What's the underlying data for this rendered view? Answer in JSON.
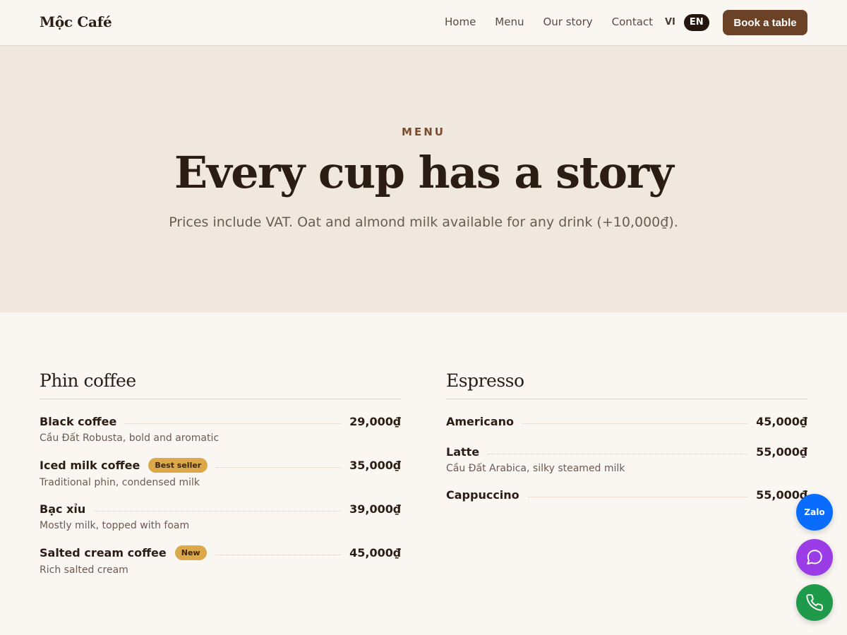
{
  "header": {
    "brand": "Mộc Café",
    "nav": [
      "Home",
      "Menu",
      "Our story",
      "Contact"
    ],
    "lang": [
      "VI",
      "EN"
    ],
    "active_lang": "EN",
    "book_label": "Book a table"
  },
  "hero": {
    "eyebrow": "MENU",
    "title": "Every cup has a story",
    "subtitle": "Prices include VAT. Oat and almond milk available for any drink (+10,000₫)."
  },
  "sections": [
    {
      "title": "Phin coffee",
      "items": [
        {
          "name": "Black coffee",
          "price": "29,000₫",
          "desc": "Cầu Đất Robusta, bold and aromatic",
          "badge": ""
        },
        {
          "name": "Iced milk coffee",
          "price": "35,000₫",
          "desc": "Traditional phin, condensed milk",
          "badge": "Best seller"
        },
        {
          "name": "Bạc xỉu",
          "price": "39,000₫",
          "desc": "Mostly milk, topped with foam",
          "badge": ""
        },
        {
          "name": "Salted cream coffee",
          "price": "45,000₫",
          "desc": "Rich salted cream",
          "badge": "New"
        }
      ]
    },
    {
      "title": "Espresso",
      "items": [
        {
          "name": "Americano",
          "price": "45,000₫",
          "desc": "",
          "badge": ""
        },
        {
          "name": "Latte",
          "price": "55,000₫",
          "desc": "Cầu Đất Arabica, silky steamed milk",
          "badge": ""
        },
        {
          "name": "Cappuccino",
          "price": "55,000₫",
          "desc": "",
          "badge": ""
        }
      ]
    }
  ],
  "floating": {
    "zalo_label": "Zalo",
    "chat_icon": "chat-bubble-icon",
    "call_icon": "phone-icon"
  },
  "colors": {
    "accent": "#6b4226",
    "hero_bg": "#f0e8de",
    "badge": "#dca84a",
    "zalo": "#0a6cff",
    "chat": "#9b3de6",
    "call": "#1f9a4a"
  }
}
